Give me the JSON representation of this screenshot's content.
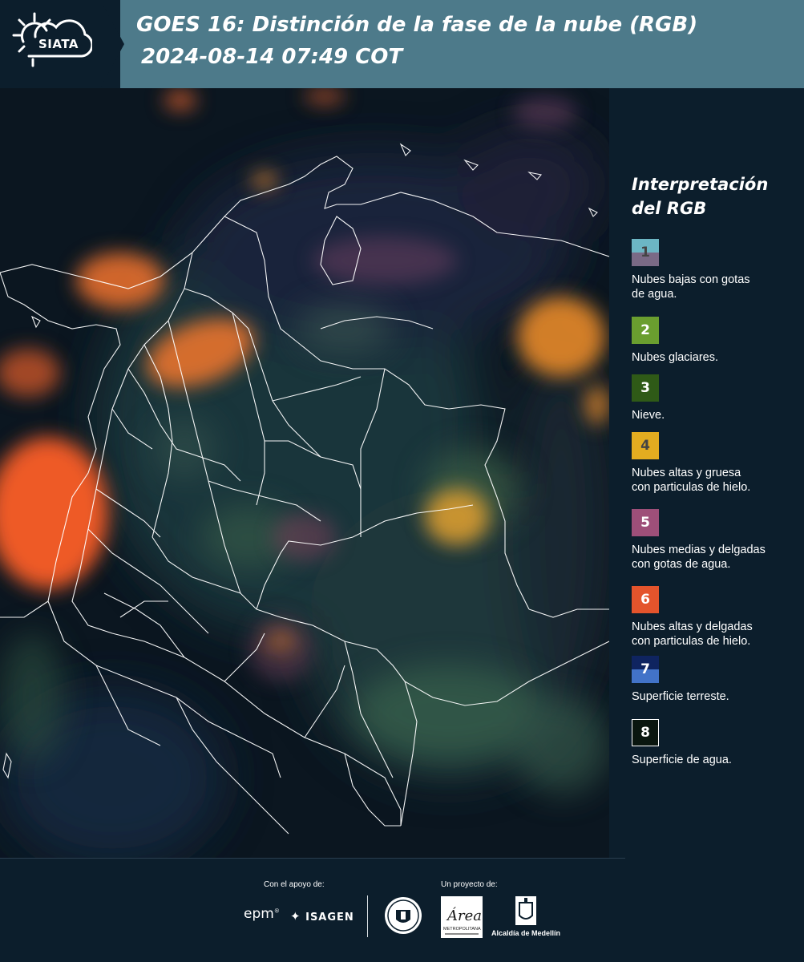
{
  "header": {
    "logo_text": "SIATA",
    "title_line_1": "GOES 16: Distinción de la fase de la nube (RGB)",
    "title_line_2": "2024-08-14 07:49 COT",
    "background_color": "#4d7a8a"
  },
  "map": {
    "satellite": "GOES 16",
    "product": "Distinción de la fase de la nube (RGB)"
  },
  "legend": {
    "title_line_1": "Interpretación",
    "title_line_2": "del RGB",
    "items": [
      {
        "number": "1",
        "label_lines": [
          "Nubes bajas con gotas",
          "de agua."
        ],
        "color_top": "#6cb6c4",
        "color_bottom": "#7a6a86",
        "number_color": "#444444"
      },
      {
        "number": "2",
        "label_lines": [
          "Nubes glaciares."
        ],
        "color_top": "#6a9e2f",
        "color_bottom": "#6a9e2f",
        "number_color": "#ffffff"
      },
      {
        "number": "3",
        "label_lines": [
          "Nieve."
        ],
        "color_top": "#2f5a17",
        "color_bottom": "#2f5a17",
        "number_color": "#ffffff"
      },
      {
        "number": "4",
        "label_lines": [
          "Nubes altas y gruesa",
          "con particulas de hielo."
        ],
        "color_top": "#e3ac20",
        "color_bottom": "#e3ac20",
        "number_color": "#444444"
      },
      {
        "number": "5",
        "label_lines": [
          "Nubes medias y delgadas",
          "con gotas de agua."
        ],
        "color_top": "#9e4f79",
        "color_bottom": "#9e4f79",
        "number_color": "#ffffff"
      },
      {
        "number": "6",
        "label_lines": [
          "Nubes altas y delgadas",
          "con particulas de hielo."
        ],
        "color_top": "#e4542c",
        "color_bottom": "#e4542c",
        "number_color": "#ffffff"
      },
      {
        "number": "7",
        "label_lines": [
          "Superficie terreste."
        ],
        "color_top": "#0f2460",
        "color_bottom": "#4273c8",
        "number_color": "#ffffff"
      },
      {
        "number": "8",
        "label_lines": [
          "Superficie de agua."
        ],
        "color_top": "#0a160f",
        "color_bottom": "#0a160f",
        "number_color": "#ffffff",
        "border_color": "#ffffff"
      }
    ]
  },
  "footer": {
    "support_label": "Con el apoyo de:",
    "project_label": "Un proyecto de:",
    "sponsor_1": "epm",
    "sponsor_2": "ISAGEN",
    "area_logo_text": "Área",
    "area_logo_subtext": "METROPOLITANA",
    "alcaldia_label": "Alcaldía de Medellín"
  }
}
